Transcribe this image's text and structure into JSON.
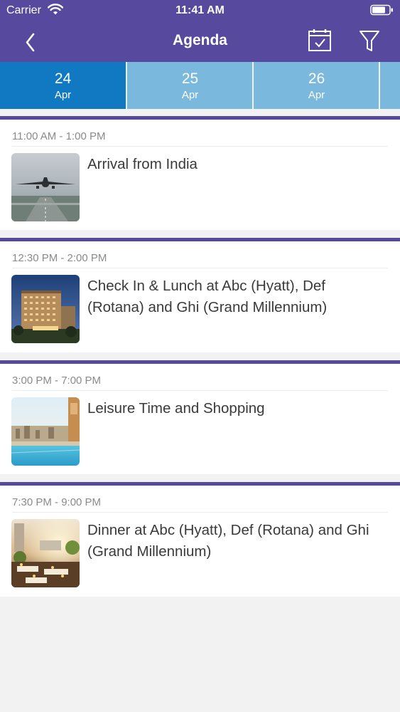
{
  "status_bar": {
    "carrier": "Carrier",
    "time": "11:41 AM"
  },
  "header": {
    "title": "Agenda",
    "back_icon": "chevron-left-icon",
    "calendar_icon": "calendar-check-icon",
    "filter_icon": "filter-icon"
  },
  "dates": [
    {
      "day": "24",
      "month": "Apr",
      "selected": true
    },
    {
      "day": "25",
      "month": "Apr",
      "selected": false
    },
    {
      "day": "26",
      "month": "Apr",
      "selected": false
    }
  ],
  "events": [
    {
      "time": "11:00 AM - 1:00 PM",
      "title": "Arrival from India",
      "image": "airplane-landing-photo"
    },
    {
      "time": "12:30 PM - 2:00 PM",
      "title": "Check In & Lunch at Abc (Hyatt), Def (Rotana) and Ghi (Grand Millennium)",
      "image": "hotel-building-photo"
    },
    {
      "time": "3:00 PM - 7:00 PM",
      "title": "Leisure Time and Shopping",
      "image": "rooftop-pool-photo"
    },
    {
      "time": "7:30 PM - 9:00 PM",
      "title": "Dinner at Abc (Hyatt), Def (Rotana) and Ghi (Grand Millennium)",
      "image": "outdoor-dinner-photo"
    }
  ],
  "colors": {
    "header": "#574a9e",
    "date_active": "#1079c1",
    "date_inactive": "#7ab8dd",
    "background": "#f2f2f2"
  }
}
